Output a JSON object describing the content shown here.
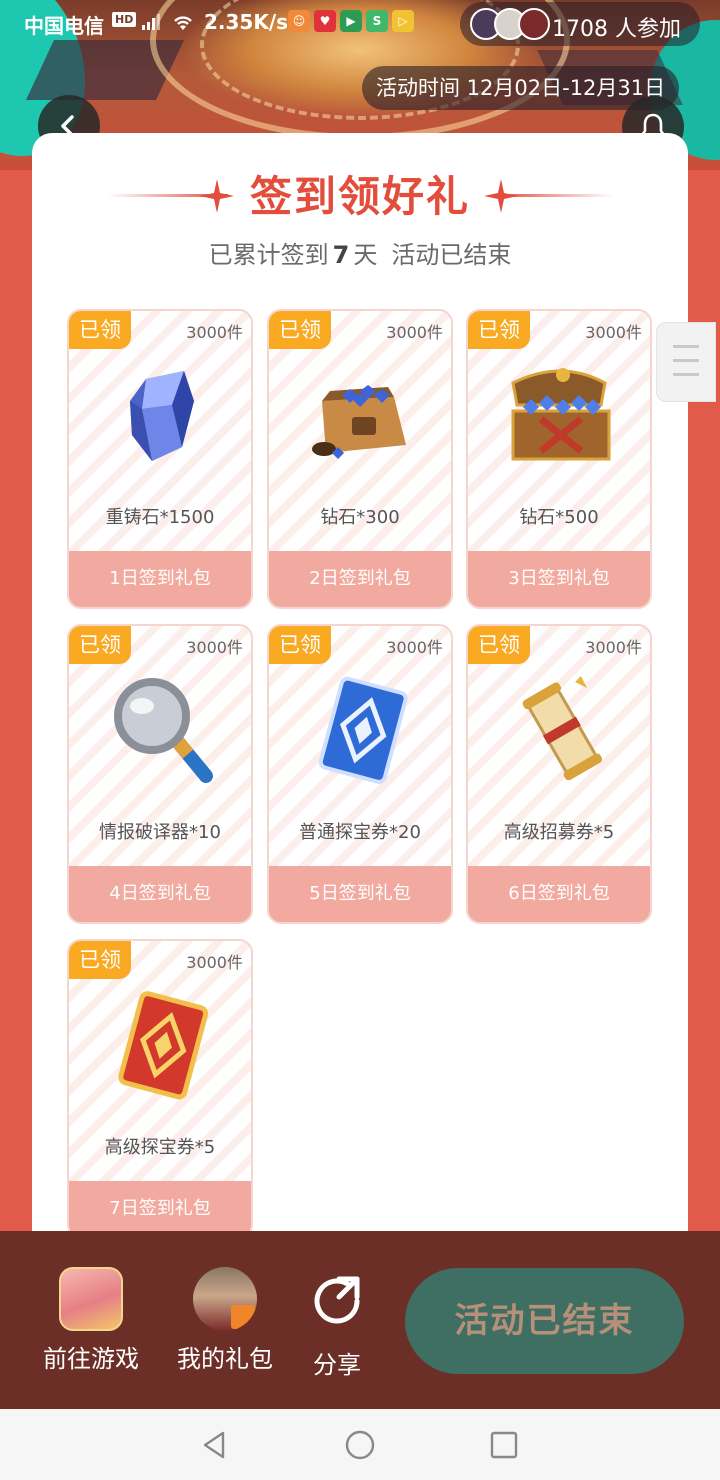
{
  "status_bar": {
    "carrier": "中国电信",
    "hd": "HD",
    "net_speed": "2.35K/s"
  },
  "header": {
    "participants": "1708 人参加",
    "activity_time": "活动时间 12月02日-12月31日"
  },
  "card": {
    "title": "签到领好礼",
    "signed_prefix": "已累计签到",
    "signed_days": "7",
    "signed_unit": "天",
    "status": "活动已结束"
  },
  "gifts": [
    {
      "badge": "已领",
      "qty": "3000件",
      "name": "重铸石*1500",
      "label": "1日签到礼包",
      "icon": "crystal-stone-icon"
    },
    {
      "badge": "已领",
      "qty": "3000件",
      "name": "钻石*300",
      "label": "2日签到礼包",
      "icon": "diamond-bag-icon"
    },
    {
      "badge": "已领",
      "qty": "3000件",
      "name": "钻石*500",
      "label": "3日签到礼包",
      "icon": "diamond-chest-icon"
    },
    {
      "badge": "已领",
      "qty": "3000件",
      "name": "情报破译器*10",
      "label": "4日签到礼包",
      "icon": "magnifier-icon"
    },
    {
      "badge": "已领",
      "qty": "3000件",
      "name": "普通探宝券*20",
      "label": "5日签到礼包",
      "icon": "blue-card-icon"
    },
    {
      "badge": "已领",
      "qty": "3000件",
      "name": "高级招募券*5",
      "label": "6日签到礼包",
      "icon": "scroll-icon"
    },
    {
      "badge": "已领",
      "qty": "3000件",
      "name": "高级探宝券*5",
      "label": "7日签到礼包",
      "icon": "red-card-icon"
    }
  ],
  "bottom_bar": {
    "goto_game": "前往游戏",
    "my_gifts": "我的礼包",
    "share": "分享",
    "ended_button": "活动已结束"
  },
  "colors": {
    "accent": "#e24d3c",
    "badge": "#f9a922",
    "footer": "#6c2f27",
    "ended_button": "#3f6e62"
  }
}
